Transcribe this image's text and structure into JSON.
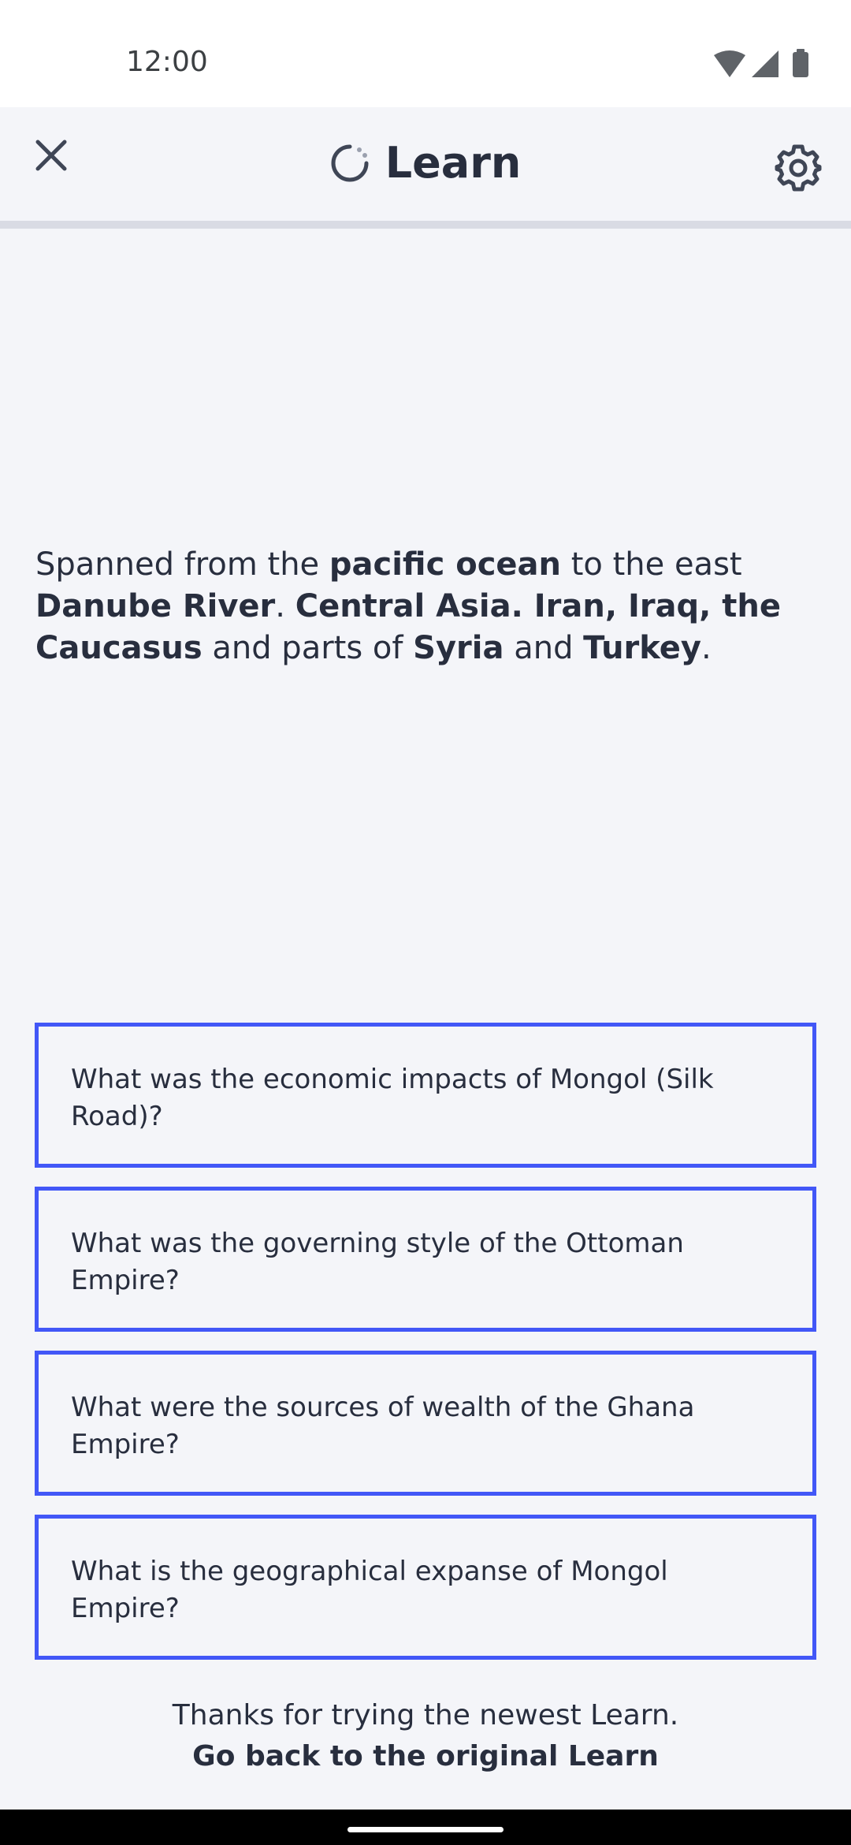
{
  "status_bar": {
    "time": "12:00"
  },
  "header": {
    "title": "Learn",
    "icons": {
      "close": "close-icon",
      "mode": "progress-ring-icon",
      "settings": "gear-icon"
    }
  },
  "prompt": {
    "segments": [
      {
        "text": "Spanned from the ",
        "bold": false
      },
      {
        "text": "pacific ocean",
        "bold": true
      },
      {
        "text": " to the east ",
        "bold": false
      },
      {
        "text": "Danube River",
        "bold": true
      },
      {
        "text": ". ",
        "bold": false
      },
      {
        "text": "Central Asia. Iran, Iraq, the Caucasus",
        "bold": true
      },
      {
        "text": " and parts of ",
        "bold": false
      },
      {
        "text": "Syria",
        "bold": true
      },
      {
        "text": " and ",
        "bold": false
      },
      {
        "text": "Turkey",
        "bold": true
      },
      {
        "text": ".",
        "bold": false
      }
    ]
  },
  "options": [
    {
      "label": "What was the economic impacts of Mongol (Silk Road)?"
    },
    {
      "label": "What was the governing style of the Ottoman Empire?"
    },
    {
      "label": "What were the sources of wealth of the Ghana Empire?"
    },
    {
      "label": "What is the geographical expanse of Mongol Empire?"
    }
  ],
  "footer": {
    "message": "Thanks for trying the newest Learn.",
    "link_label": "Go back to the original Learn"
  },
  "colors": {
    "background": "#f4f5f9",
    "text": "#282e3e",
    "option_border": "#4257f7",
    "divider": "#d9dbe4"
  }
}
